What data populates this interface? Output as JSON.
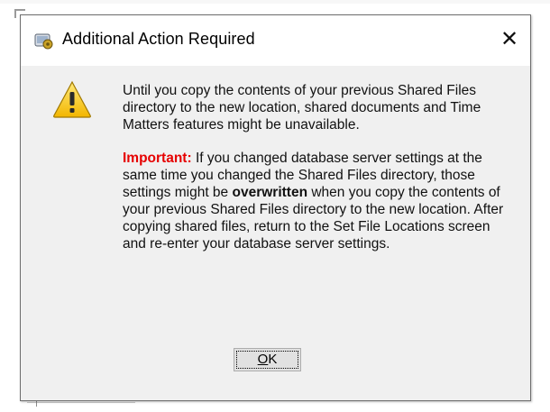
{
  "dialog": {
    "title": "Additional Action Required",
    "close_glyph": "✕",
    "app_icon": "settings-app-icon",
    "warning_icon": "warning-icon",
    "message": {
      "paragraph1": "Until you copy the contents of your previous Shared Files directory to the new location, shared documents and Time Matters features might be unavailable.",
      "important_label": "Important:",
      "paragraph2_part1": " If you changed database server settings at the same time you changed the Shared Files directory, those settings might be ",
      "paragraph2_emphasis": "overwritten",
      "paragraph2_part2": " when you copy the contents of your previous Shared Files directory to the new location. After copying shared files, return to the Set File Locations screen and re-enter your database server settings."
    },
    "ok_button": {
      "mnemonic": "O",
      "rest": "K"
    },
    "colors": {
      "important": "#e60000",
      "dialog_bg": "#f0f0f0",
      "button_bg": "#e1e1e1"
    }
  }
}
